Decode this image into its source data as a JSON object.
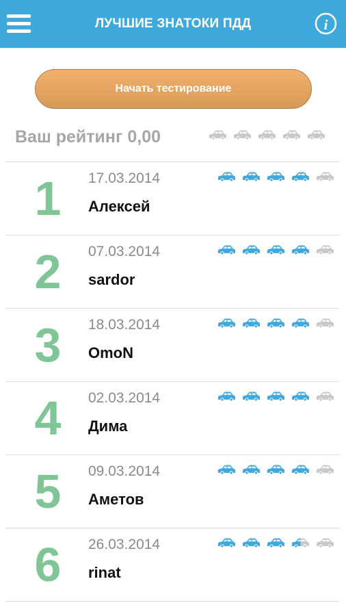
{
  "header": {
    "title": "ЛУЧШИЕ ЗНАТОКИ ПДД",
    "menu_icon": "hamburger-menu-icon",
    "info_icon": "info-icon"
  },
  "start_button": {
    "label": "Начать тестирование"
  },
  "user_rating": {
    "label": "Ваш рейтинг 0,00",
    "cars_filled": 0,
    "cars_total": 5
  },
  "colors": {
    "header_bg": "#40a9dc",
    "button_orange": "#e8a663",
    "rank_green": "#7fc596",
    "car_active": "#3fa8dc",
    "car_inactive": "#c8c8c8"
  },
  "leaderboard": [
    {
      "rank": "1",
      "date": "17.03.2014",
      "name": "Алексей",
      "cars_filled": 4
    },
    {
      "rank": "2",
      "date": "07.03.2014",
      "name": "sardor",
      "cars_filled": 4
    },
    {
      "rank": "3",
      "date": "18.03.2014",
      "name": "OmoN",
      "cars_filled": 4
    },
    {
      "rank": "4",
      "date": "02.03.2014",
      "name": "Дима",
      "cars_filled": 4
    },
    {
      "rank": "5",
      "date": "09.03.2014",
      "name": "Аметов",
      "cars_filled": 4
    },
    {
      "rank": "6",
      "date": "26.03.2014",
      "name": "rinat",
      "cars_filled": 3.5
    }
  ]
}
